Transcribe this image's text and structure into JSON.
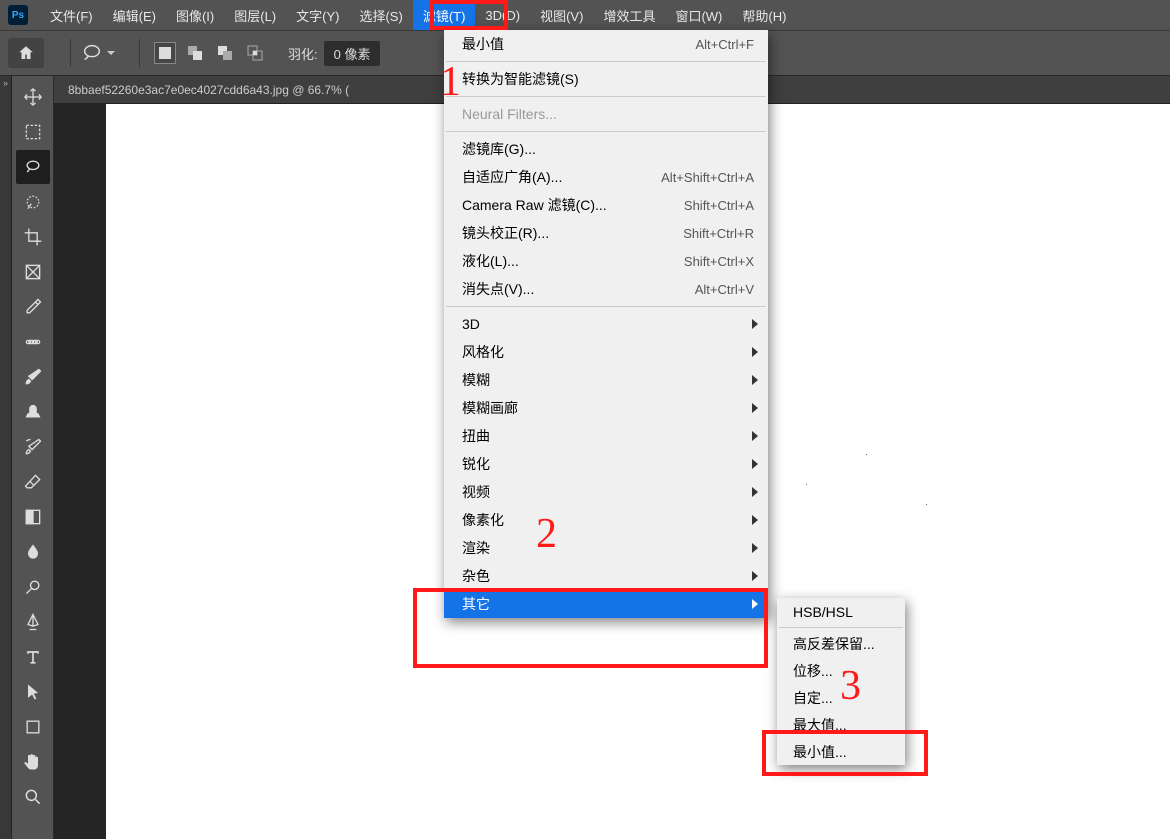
{
  "menubar": {
    "items": [
      {
        "label": "文件(F)"
      },
      {
        "label": "编辑(E)"
      },
      {
        "label": "图像(I)"
      },
      {
        "label": "图层(L)"
      },
      {
        "label": "文字(Y)"
      },
      {
        "label": "选择(S)"
      },
      {
        "label": "滤镜(T)"
      },
      {
        "label": "3D(D)"
      },
      {
        "label": "视图(V)"
      },
      {
        "label": "增效工具"
      },
      {
        "label": "窗口(W)"
      },
      {
        "label": "帮助(H)"
      }
    ],
    "active_index": 6
  },
  "optbar": {
    "feather_label": "羽化:",
    "feather_value": "0 像素"
  },
  "doc_tab": "8bbaef52260e3ac7e0ec4027cdd6a43.jpg @ 66.7% (",
  "dropdown": {
    "last_filter": {
      "label": "最小值",
      "shortcut": "Alt+Ctrl+F"
    },
    "smart": "转换为智能滤镜(S)",
    "neural": "Neural Filters...",
    "group2": [
      {
        "label": "滤镜库(G)...",
        "shortcut": ""
      },
      {
        "label": "自适应广角(A)...",
        "shortcut": "Alt+Shift+Ctrl+A"
      },
      {
        "label": "Camera Raw 滤镜(C)...",
        "shortcut": "Shift+Ctrl+A"
      },
      {
        "label": "镜头校正(R)...",
        "shortcut": "Shift+Ctrl+R"
      },
      {
        "label": "液化(L)...",
        "shortcut": "Shift+Ctrl+X"
      },
      {
        "label": "消失点(V)...",
        "shortcut": "Alt+Ctrl+V"
      }
    ],
    "group3": [
      {
        "label": "3D"
      },
      {
        "label": "风格化"
      },
      {
        "label": "模糊"
      },
      {
        "label": "模糊画廊"
      },
      {
        "label": "扭曲"
      },
      {
        "label": "锐化"
      },
      {
        "label": "视频"
      },
      {
        "label": "像素化"
      },
      {
        "label": "渲染"
      },
      {
        "label": "杂色"
      },
      {
        "label": "其它"
      }
    ],
    "selected_group3_index": 10
  },
  "submenu": {
    "items": [
      {
        "label": "HSB/HSL"
      },
      {
        "label": "高反差保留..."
      },
      {
        "label": "位移..."
      },
      {
        "label": "自定..."
      },
      {
        "label": "最大值..."
      },
      {
        "label": "最小值..."
      }
    ]
  },
  "callouts": {
    "n1": "1",
    "n2": "2",
    "n3": "3"
  }
}
